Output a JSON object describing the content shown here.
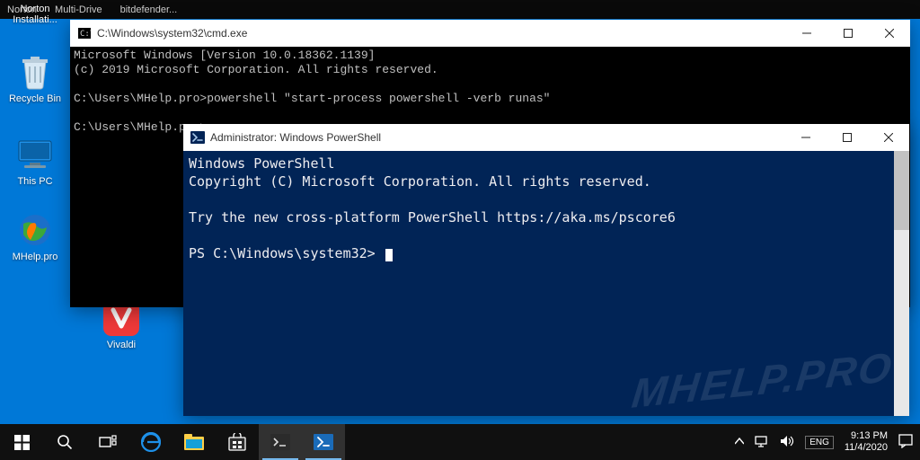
{
  "bookmarks": [
    "Norton",
    "Multi-Drive",
    "bitdefender..."
  ],
  "desktop": {
    "norton_label": "Norton Installati...",
    "recycle_label": "Recycle Bin",
    "thispc_label": "This PC",
    "mhelp_label": "MHelp.pro",
    "vivaldi_label": "Vivaldi"
  },
  "cmd": {
    "title": "C:\\Windows\\system32\\cmd.exe",
    "line1": "Microsoft Windows [Version 10.0.18362.1139]",
    "line2": "(c) 2019 Microsoft Corporation. All rights reserved.",
    "line3": "C:\\Users\\MHelp.pro>powershell \"start-process powershell -verb runas\"",
    "line4": "C:\\Users\\MHelp.pro>"
  },
  "ps": {
    "title": "Administrator: Windows PowerShell",
    "line1": "Windows PowerShell",
    "line2": "Copyright (C) Microsoft Corporation. All rights reserved.",
    "line3": "Try the new cross-platform PowerShell https://aka.ms/pscore6",
    "prompt": "PS C:\\Windows\\system32> "
  },
  "watermark": "MHELP.PRO",
  "tray": {
    "lang": "ENG",
    "time": "9:13 PM",
    "date": "11/4/2020"
  }
}
